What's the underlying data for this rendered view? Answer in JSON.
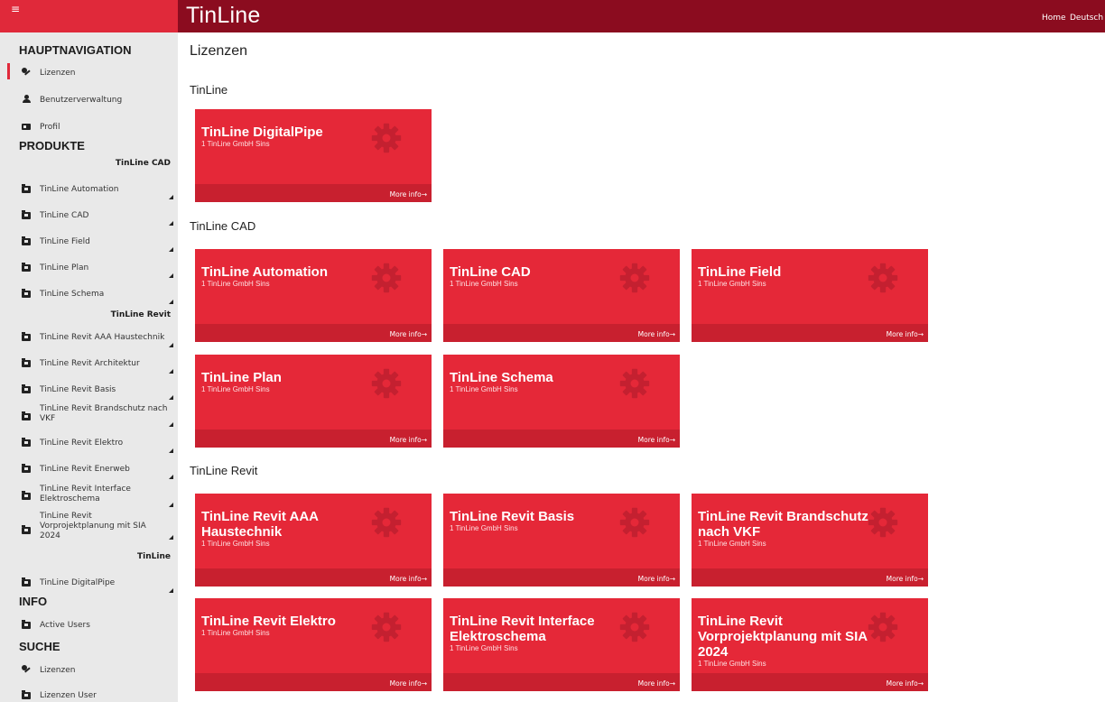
{
  "topbar": {
    "menu_icon": "≡",
    "brand": "TinLine",
    "nav": [
      "Home",
      "Deutsch"
    ]
  },
  "sidebar": {
    "hauptnavigation": "HAUPTNAVIGATION",
    "main_items": [
      {
        "label": "Lizenzen",
        "icon": "key-icon"
      },
      {
        "label": "Benutzerverwaltung",
        "icon": "user-icon"
      },
      {
        "label": "Profil",
        "icon": "id-card-icon"
      }
    ],
    "produkte": "PRODUKTE",
    "groups": [
      {
        "title": "TinLine CAD",
        "items": [
          "TinLine Automation",
          "TinLine CAD",
          "TinLine Field",
          "TinLine Plan",
          "TinLine Schema"
        ]
      },
      {
        "title": "TinLine Revit",
        "items": [
          "TinLine Revit AAA Haustechnik",
          "TinLine Revit Architektur",
          "TinLine Revit Basis",
          "TinLine Revit Brandschutz nach VKF",
          "TinLine Revit Elektro",
          "TinLine Revit Enerweb",
          "TinLine Revit Interface Elektroschema",
          "TinLine Revit Vorprojektplanung mit SIA 2024"
        ]
      },
      {
        "title": "TinLine",
        "items": [
          "TinLine DigitalPipe"
        ]
      }
    ],
    "info": "INFO",
    "info_items": [
      "Active Users"
    ],
    "suche": "SUCHE",
    "suche_items": [
      {
        "label": "Lizenzen",
        "icon": "key-icon"
      },
      {
        "label": "Lizenzen User",
        "icon": "folder-icon"
      }
    ]
  },
  "main": {
    "title": "Lizenzen",
    "more_info": "More info",
    "company": "1 TinLine GmbH Sins",
    "groups": [
      {
        "title": "TinLine",
        "tiles": [
          "TinLine DigitalPipe"
        ]
      },
      {
        "title": "TinLine CAD",
        "tiles": [
          "TinLine Automation",
          "TinLine CAD",
          "TinLine Field",
          "TinLine Plan",
          "TinLine Schema"
        ]
      },
      {
        "title": "TinLine Revit",
        "tiles": [
          "TinLine Revit AAA Haustechnik",
          "TinLine Revit Basis",
          "TinLine Revit Brandschutz nach VKF",
          "TinLine Revit Elektro",
          "TinLine Revit Interface Elektroschema",
          "TinLine Revit Vorprojektplanung mit SIA 2024"
        ]
      }
    ]
  },
  "colors": {
    "topbar": "#8b0c1f",
    "accent": "#e52838",
    "tile_footer": "#c8202f",
    "sidebar": "#e9e9e9"
  }
}
